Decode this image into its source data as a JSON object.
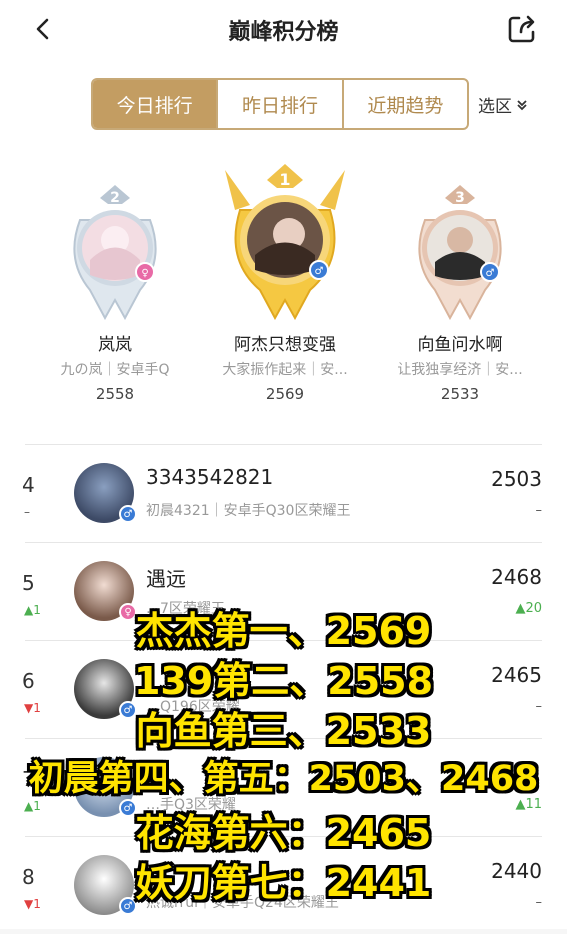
{
  "header": {
    "title": "巅峰积分榜"
  },
  "tabs": [
    {
      "label": "今日排行",
      "active": true
    },
    {
      "label": "昨日排行",
      "active": false
    },
    {
      "label": "近期趋势",
      "active": false
    }
  ],
  "region": {
    "label": "选区"
  },
  "podium": [
    {
      "rank": "2",
      "name": "岚岚",
      "sub": "九の岚｜安卓手Q",
      "score": "2558",
      "gender": "female"
    },
    {
      "rank": "1",
      "name": "阿杰只想变强",
      "sub": "大家振作起来｜安...",
      "score": "2569",
      "gender": "male"
    },
    {
      "rank": "3",
      "name": "向鱼问水啊",
      "sub": "让我独享经济｜安...",
      "score": "2533",
      "gender": "male"
    }
  ],
  "rows": [
    {
      "rank": "4",
      "delta": "–",
      "name": "3343542821",
      "sub": "初晨4321｜安卓手Q30区荣耀王",
      "score": "2503",
      "score_delta": "–",
      "gender": "male"
    },
    {
      "rank": "5",
      "delta": "▲1",
      "name": "遇远",
      "sub": "…7区荣耀王",
      "score": "2468",
      "score_delta": "▲20",
      "gender": "female"
    },
    {
      "rank": "6",
      "delta": "▼1",
      "name": "",
      "sub": "…Q196区荣耀",
      "score": "2465",
      "score_delta": "–",
      "gender": "male"
    },
    {
      "rank": "7",
      "delta": "▲1",
      "name": "",
      "sub": "…手Q3区荣耀",
      "score": "",
      "score_delta": "▲11",
      "gender": "male"
    },
    {
      "rank": "8",
      "delta": "▼1",
      "name": "",
      "sub": "热诚rrui｜安卓手Q24区荣耀王",
      "score": "2440",
      "score_delta": "–",
      "gender": "male"
    }
  ],
  "overlay": [
    "杰杰第一、2569",
    "139第二、2558",
    "向鱼第三、2533",
    "初晨第四、第五：2503、2468",
    "花海第六：2465",
    "妖刀第七：2441"
  ],
  "colors": {
    "accent": "#c39d62",
    "overlay_text": "#ffe400",
    "up": "#4caf50",
    "down": "#e04040"
  }
}
